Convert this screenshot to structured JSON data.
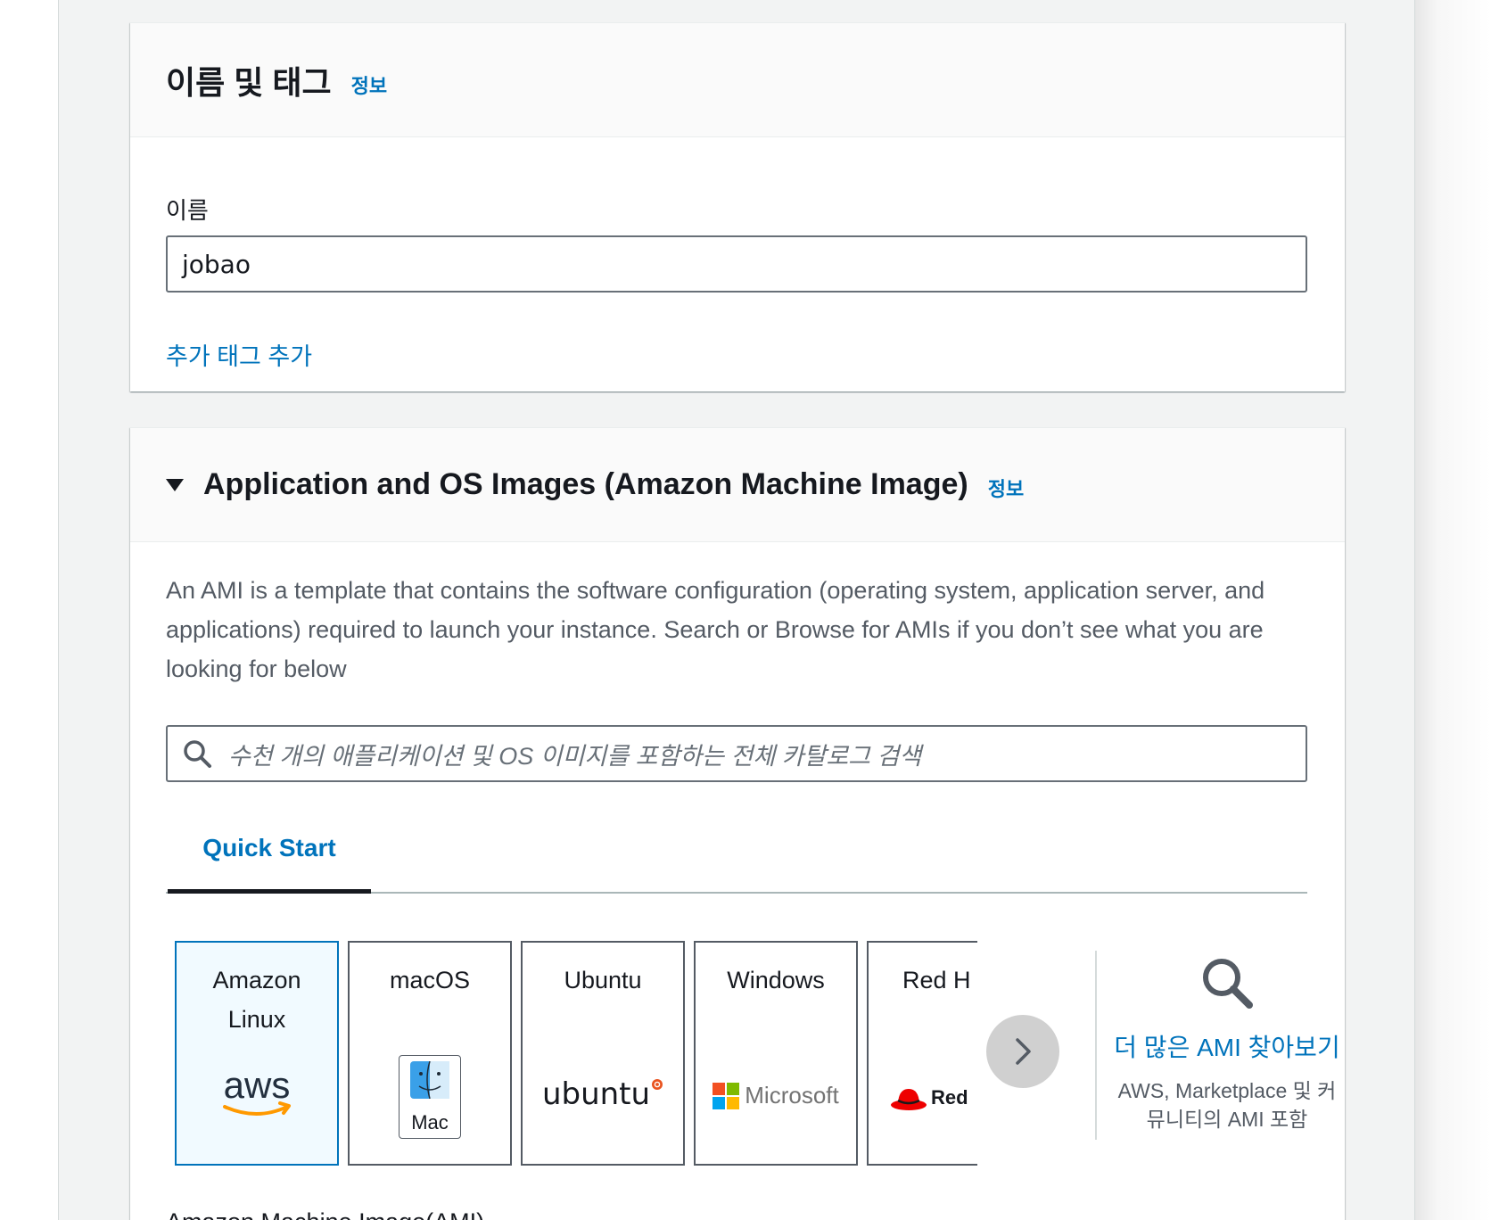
{
  "name_tags": {
    "title": "이름 및 태그",
    "info": "정보",
    "name_label": "이름",
    "name_value": "jobao",
    "add_tag": "추가 태그 추가"
  },
  "ami_section": {
    "title": "Application and OS Images (Amazon Machine Image)",
    "info": "정보",
    "description": "An AMI is a template that contains the software configuration (operating system, application server, and applications) required to launch your instance. Search or Browse for AMIs if you don’t see what you are looking for below",
    "search_placeholder": "수천 개의 애플리케이션 및 OS 이미지를 포함하는 전체 카탈로그 검색",
    "tab_quick_start": "Quick Start",
    "tiles": [
      {
        "label_line1": "Amazon",
        "label_line2": "Linux",
        "logo_text": "aws",
        "selected": true
      },
      {
        "label_line1": "macOS",
        "logo_text": "Mac"
      },
      {
        "label_line1": "Ubuntu",
        "logo_text": "ubuntu"
      },
      {
        "label_line1": "Windows",
        "logo_text": "Microsoft"
      },
      {
        "label_line1": "Red H",
        "logo_text": "Red"
      }
    ],
    "browse_more": "더 많은 AMI 찾아보기",
    "browse_sub": "AWS, Marketplace 및 커뮤니티의 AMI 포함",
    "ami_label": "Amazon Machine Image(AMI)"
  },
  "colors": {
    "link": "#0073bb",
    "text": "#16191f",
    "secondary_text": "#545b64",
    "selected_tile_bg": "#f1faff"
  }
}
